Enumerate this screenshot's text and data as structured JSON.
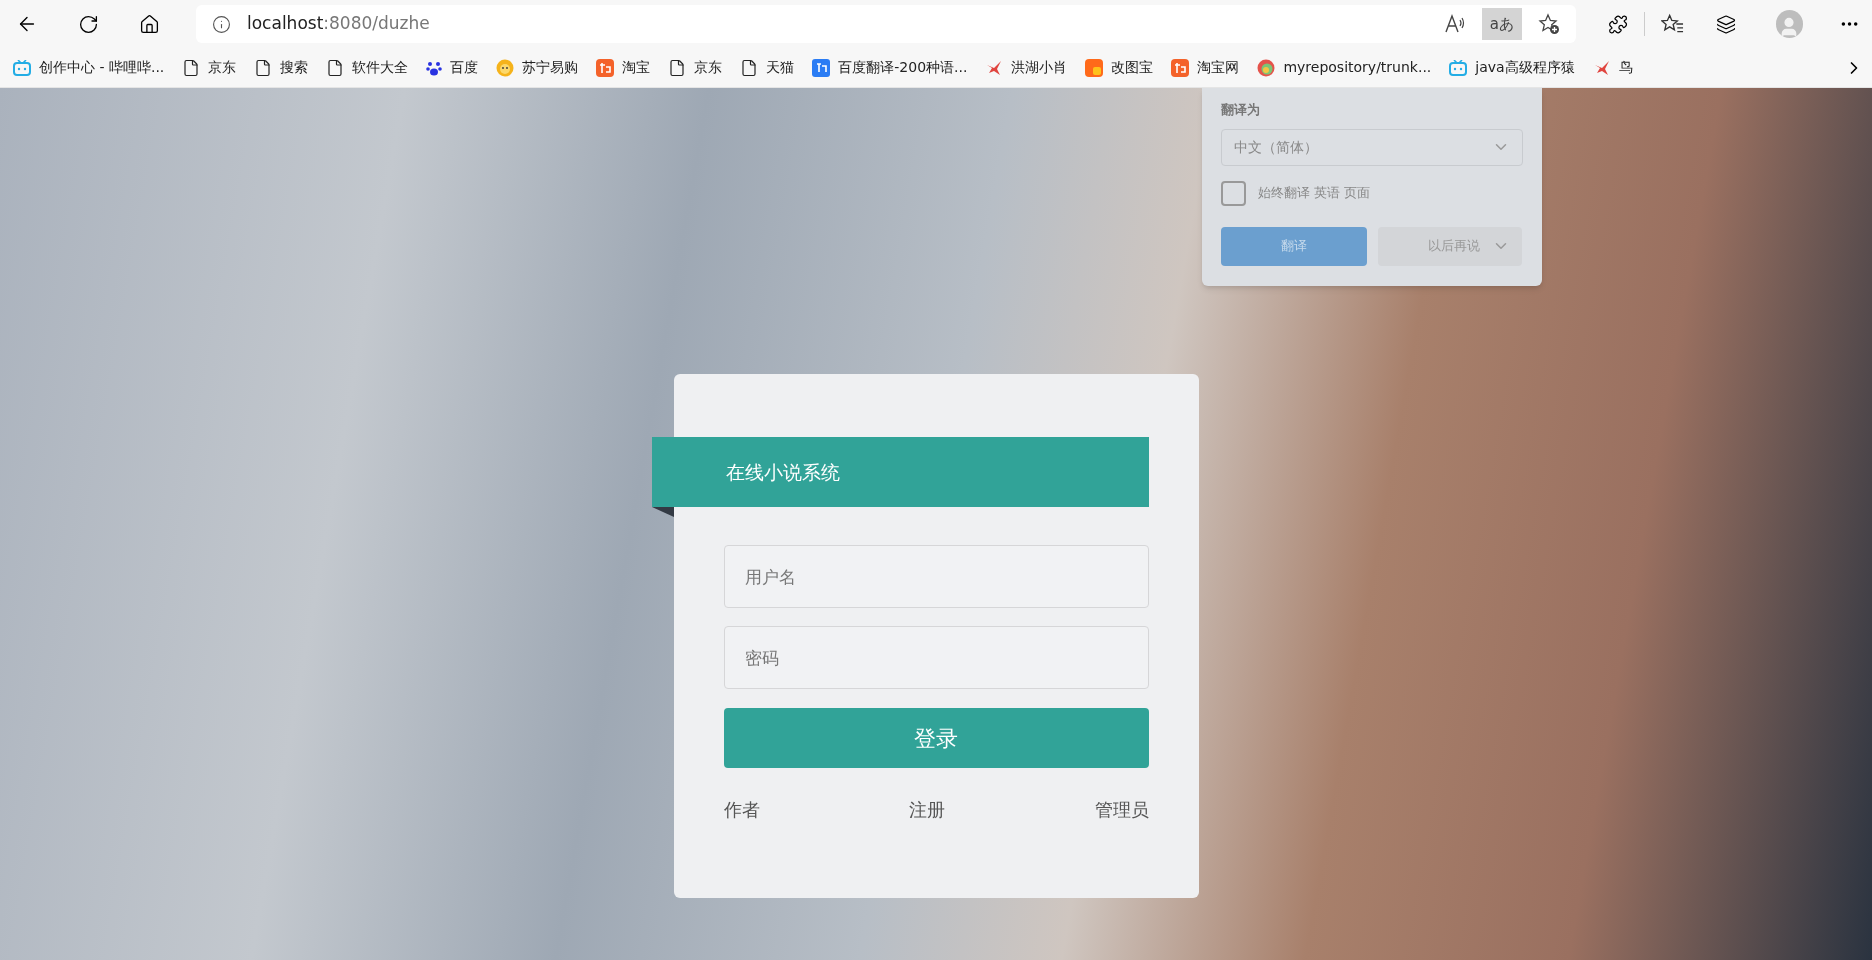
{
  "browser": {
    "address_host": "localhost",
    "address_path": ":8080/duzhe",
    "translate_glyph": "aあ",
    "translate_active": true
  },
  "bookmarks": [
    {
      "kind": "tv",
      "label": "创作中心 - 哔哩哔..."
    },
    {
      "kind": "page",
      "label": "京东"
    },
    {
      "kind": "page",
      "label": "搜索"
    },
    {
      "kind": "page",
      "label": "软件大全"
    },
    {
      "kind": "paw",
      "label": "百度"
    },
    {
      "kind": "sun",
      "label": "苏宁易购"
    },
    {
      "kind": "tao",
      "label": "淘宝"
    },
    {
      "kind": "page",
      "label": "京东"
    },
    {
      "kind": "page",
      "label": "天猫"
    },
    {
      "kind": "fanyi",
      "label": "百度翻译-200种语..."
    },
    {
      "kind": "bird",
      "label": "洪湖小肖"
    },
    {
      "kind": "square",
      "label": "改图宝"
    },
    {
      "kind": "tao",
      "label": "淘宝网"
    },
    {
      "kind": "circle",
      "label": "myrepository/trunk..."
    },
    {
      "kind": "tv",
      "label": "java高级程序猿"
    },
    {
      "kind": "bird",
      "label": "鸟"
    }
  ],
  "translate_popup": {
    "label": "翻译为",
    "language": "中文（简体）",
    "always": {
      "label": "始终翻译 英语 页面",
      "checked": false
    },
    "translate_button": "翻译",
    "later_button": "以后再说"
  },
  "login": {
    "title": "在线小说系统",
    "username_placeholder": "用户名",
    "password_placeholder": "密码",
    "submit": "登录",
    "links": [
      "作者",
      "注册",
      "管理员"
    ]
  }
}
